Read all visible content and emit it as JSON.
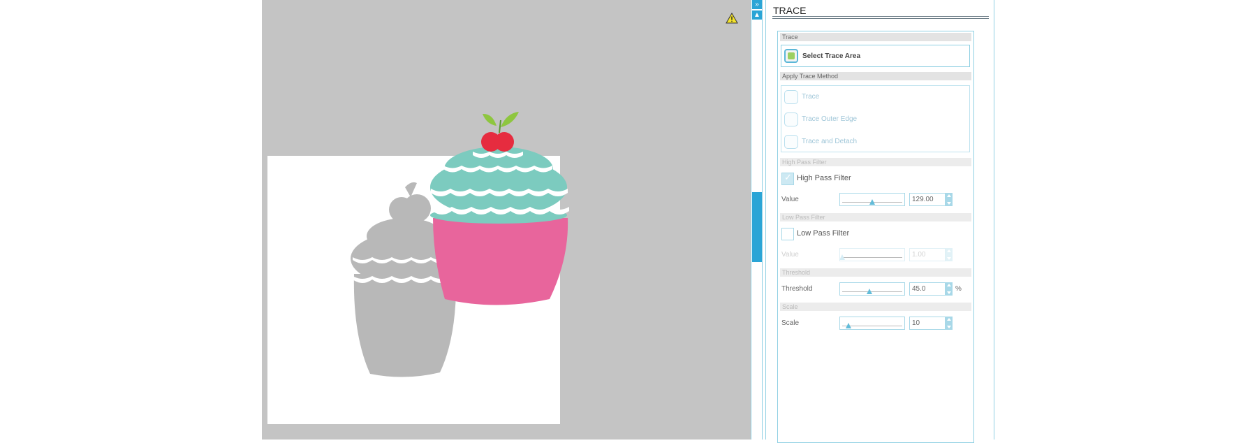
{
  "canvas": {
    "warning_icon": "warning-triangle-icon",
    "colors": {
      "workspace": "#c4c4c4",
      "mat": "#ffffff",
      "shadow": "#b8b8b8",
      "frosting": "#7ccbbf",
      "cup": "#e8659c",
      "cherry": "#e62c3f",
      "leaf": "#8ec63f"
    }
  },
  "scrollbar": {
    "collapse_icon": "double-chevron-right-icon",
    "up_icon": "triangle-up-icon"
  },
  "panel": {
    "title": "TRACE",
    "trace_section": "Trace",
    "select_trace_area": "Select Trace Area",
    "apply_method_section": "Apply Trace Method",
    "methods": [
      {
        "label": "Trace",
        "icon": "trace-icon"
      },
      {
        "label": "Trace Outer Edge",
        "icon": "trace-outer-edge-icon"
      },
      {
        "label": "Trace and Detach",
        "icon": "trace-and-detach-icon"
      }
    ],
    "high_pass": {
      "section": "High Pass Filter",
      "checkbox_label": "High Pass Filter",
      "checked": true,
      "value_label": "Value",
      "value": "129.00",
      "level": 0.5
    },
    "low_pass": {
      "section": "Low Pass Filter",
      "checkbox_label": "Low Pass Filter",
      "checked": false,
      "value_label": "Value",
      "value": "1.00",
      "level": 0.0
    },
    "threshold": {
      "section": "Threshold",
      "label": "Threshold",
      "value": "45.0",
      "unit": "%",
      "level": 0.45
    },
    "scale": {
      "section": "Scale",
      "label": "Scale",
      "value": "10",
      "level": 0.1
    }
  }
}
